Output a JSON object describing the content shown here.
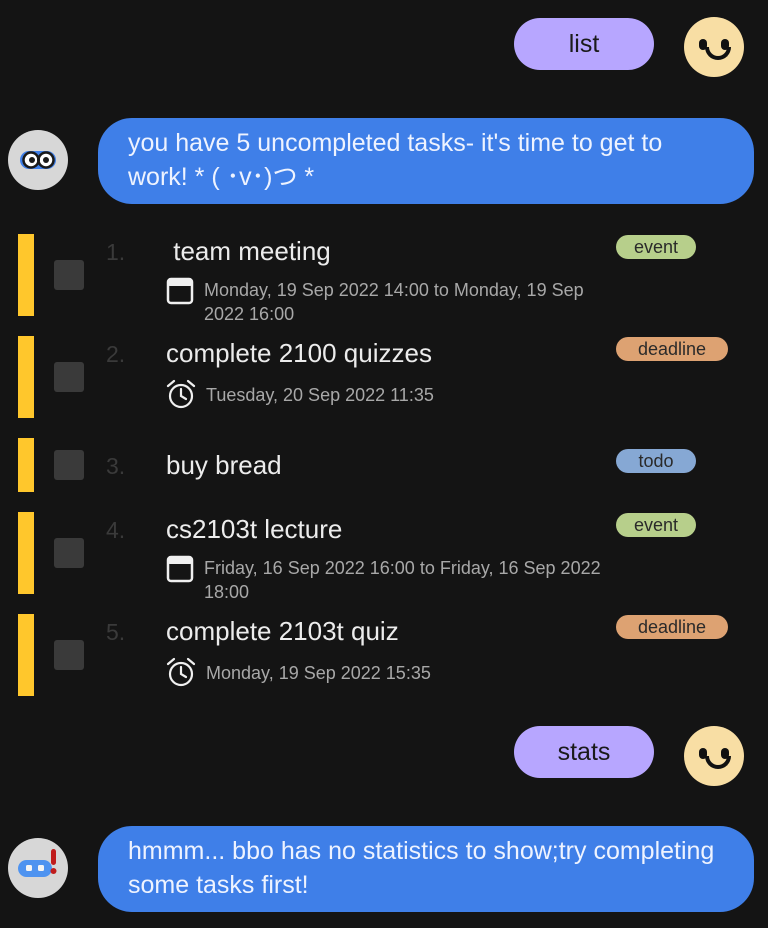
{
  "conversation": {
    "user_cmd_1": "list",
    "bot_reply_1": "you have 5 uncompleted tasks- it's time to get to work! * ( ･v･)つ *",
    "user_cmd_2": "stats",
    "bot_reply_2": "hmmm... bbo has no statistics to show;try completing some tasks first!"
  },
  "tasks": [
    {
      "num": "1.",
      "title": " team meeting",
      "tag": "event",
      "detail": "Monday, 19 Sep 2022 14:00 to Monday, 19 Sep 2022 16:00",
      "detail_icon": "calendar-icon"
    },
    {
      "num": "2.",
      "title": "complete 2100 quizzes",
      "tag": "deadline",
      "detail": "Tuesday, 20 Sep 2022 11:35",
      "detail_icon": "alarm-clock-icon"
    },
    {
      "num": "3.",
      "title": "buy bread",
      "tag": "todo",
      "detail": "",
      "detail_icon": ""
    },
    {
      "num": "4.",
      "title": "cs2103t lecture",
      "tag": "event",
      "detail": "Friday, 16 Sep 2022 16:00 to Friday, 16 Sep 2022 18:00",
      "detail_icon": "calendar-icon"
    },
    {
      "num": "5.",
      "title": "complete 2103t quiz",
      "tag": "deadline",
      "detail": "Monday, 19 Sep 2022 15:35",
      "detail_icon": "alarm-clock-icon"
    }
  ],
  "colors": {
    "background": "#141414",
    "user_bubble": "#b7a6ff",
    "bot_bubble": "#3f7fe8",
    "task_bar": "#ffc72c",
    "tag_event": "#b7cf8b",
    "tag_deadline": "#dda272",
    "tag_todo": "#86a8d4"
  }
}
